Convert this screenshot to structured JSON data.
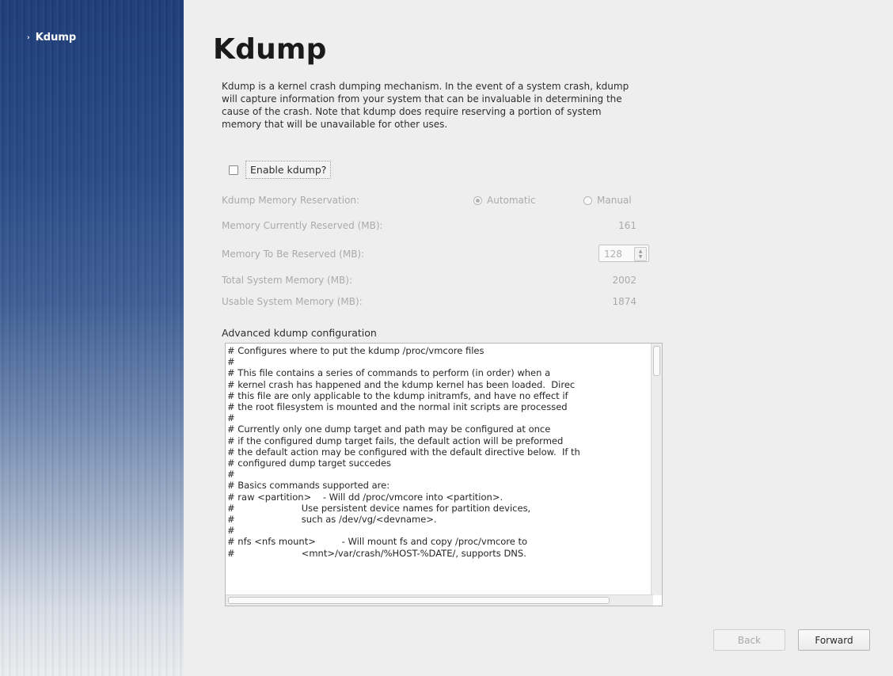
{
  "sidebar": {
    "items": [
      {
        "label": "Kdump",
        "arrow": "›"
      }
    ]
  },
  "page": {
    "title": "Kdump",
    "description": "Kdump is a kernel crash dumping mechanism. In the event of a system crash, kdump will capture information from your system that can be invaluable in determining the cause of the crash. Note that kdump does require reserving a portion of system memory that will be unavailable for other uses."
  },
  "enable": {
    "label": "Enable kdump?",
    "checked": false
  },
  "memory": {
    "reservation_label": "Kdump Memory Reservation:",
    "automatic_label": "Automatic",
    "manual_label": "Manual",
    "selected": "Automatic",
    "currently_reserved_label": "Memory Currently Reserved (MB):",
    "currently_reserved_value": "161",
    "to_be_reserved_label": "Memory To Be Reserved (MB):",
    "to_be_reserved_value": "128",
    "total_label": "Total System Memory (MB):",
    "total_value": "2002",
    "usable_label": "Usable System Memory (MB):",
    "usable_value": "1874"
  },
  "advanced": {
    "label": "Advanced kdump configuration",
    "config_text": "# Configures where to put the kdump /proc/vmcore files\n#\n# This file contains a series of commands to perform (in order) when a\n# kernel crash has happened and the kdump kernel has been loaded.  Direc\n# this file are only applicable to the kdump initramfs, and have no effect if\n# the root filesystem is mounted and the normal init scripts are processed\n#\n# Currently only one dump target and path may be configured at once\n# if the configured dump target fails, the default action will be preformed\n# the default action may be configured with the default directive below.  If th\n# configured dump target succedes\n#\n# Basics commands supported are:\n# raw <partition>    - Will dd /proc/vmcore into <partition>.\n#                       Use persistent device names for partition devices,\n#                       such as /dev/vg/<devname>.\n#\n# nfs <nfs mount>         - Will mount fs and copy /proc/vmcore to\n#                       <mnt>/var/crash/%HOST-%DATE/, supports DNS."
  },
  "buttons": {
    "back": "Back",
    "forward": "Forward"
  }
}
